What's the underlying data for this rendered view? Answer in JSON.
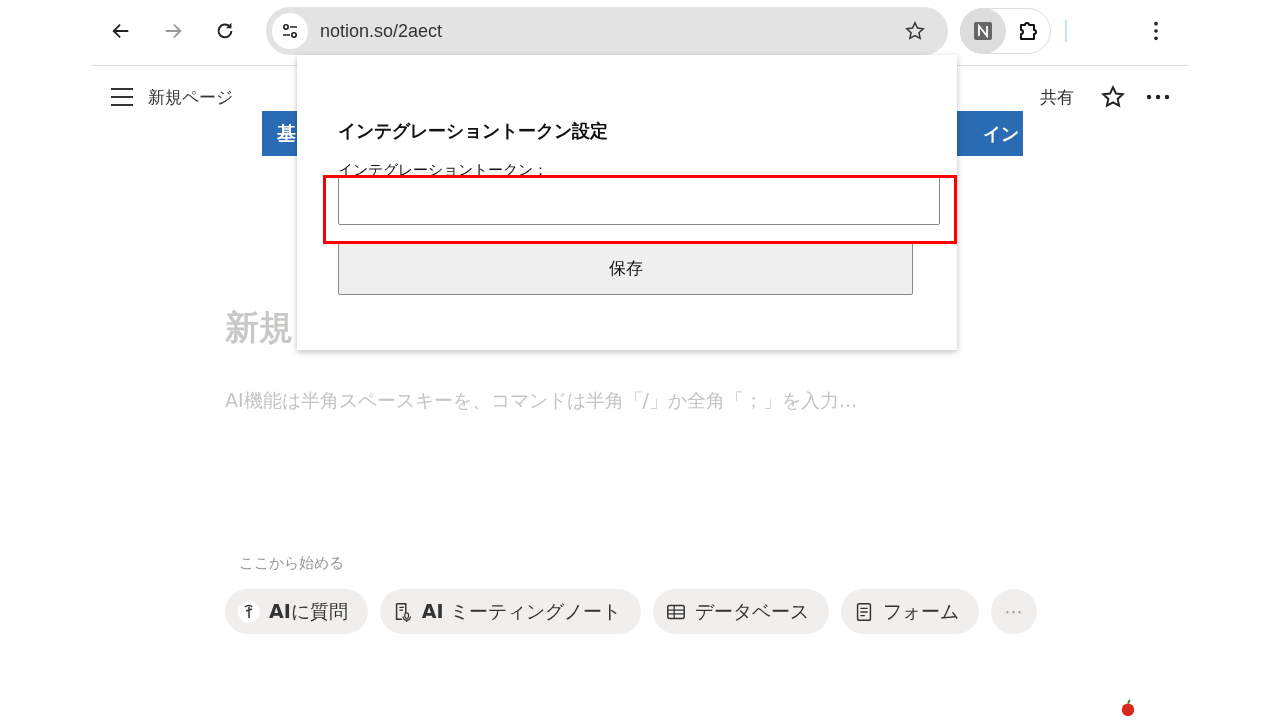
{
  "browser": {
    "url": "notion.so/2aect"
  },
  "page_header": {
    "title": "新規ページ",
    "share": "共有"
  },
  "banner_fragments": [
    "基",
    "イン"
  ],
  "page": {
    "title": "新規",
    "placeholder": "AI機能は半角スペースキーを、コマンドは半角「/」か全角「；」を入力...",
    "start_label": "ここから始める",
    "chips": [
      {
        "kind": "ai",
        "label": "**AI**に質問"
      },
      {
        "kind": "meeting",
        "label": "**AI** ミーティングノート"
      },
      {
        "kind": "database",
        "label": "データベース"
      },
      {
        "kind": "form",
        "label": "フォーム"
      },
      {
        "kind": "more",
        "label": "⋯"
      }
    ]
  },
  "popup": {
    "title": "インテグレーショントークン設定",
    "field_label": "インテグレーショントークン：",
    "button": "保存",
    "highlighted": true
  }
}
